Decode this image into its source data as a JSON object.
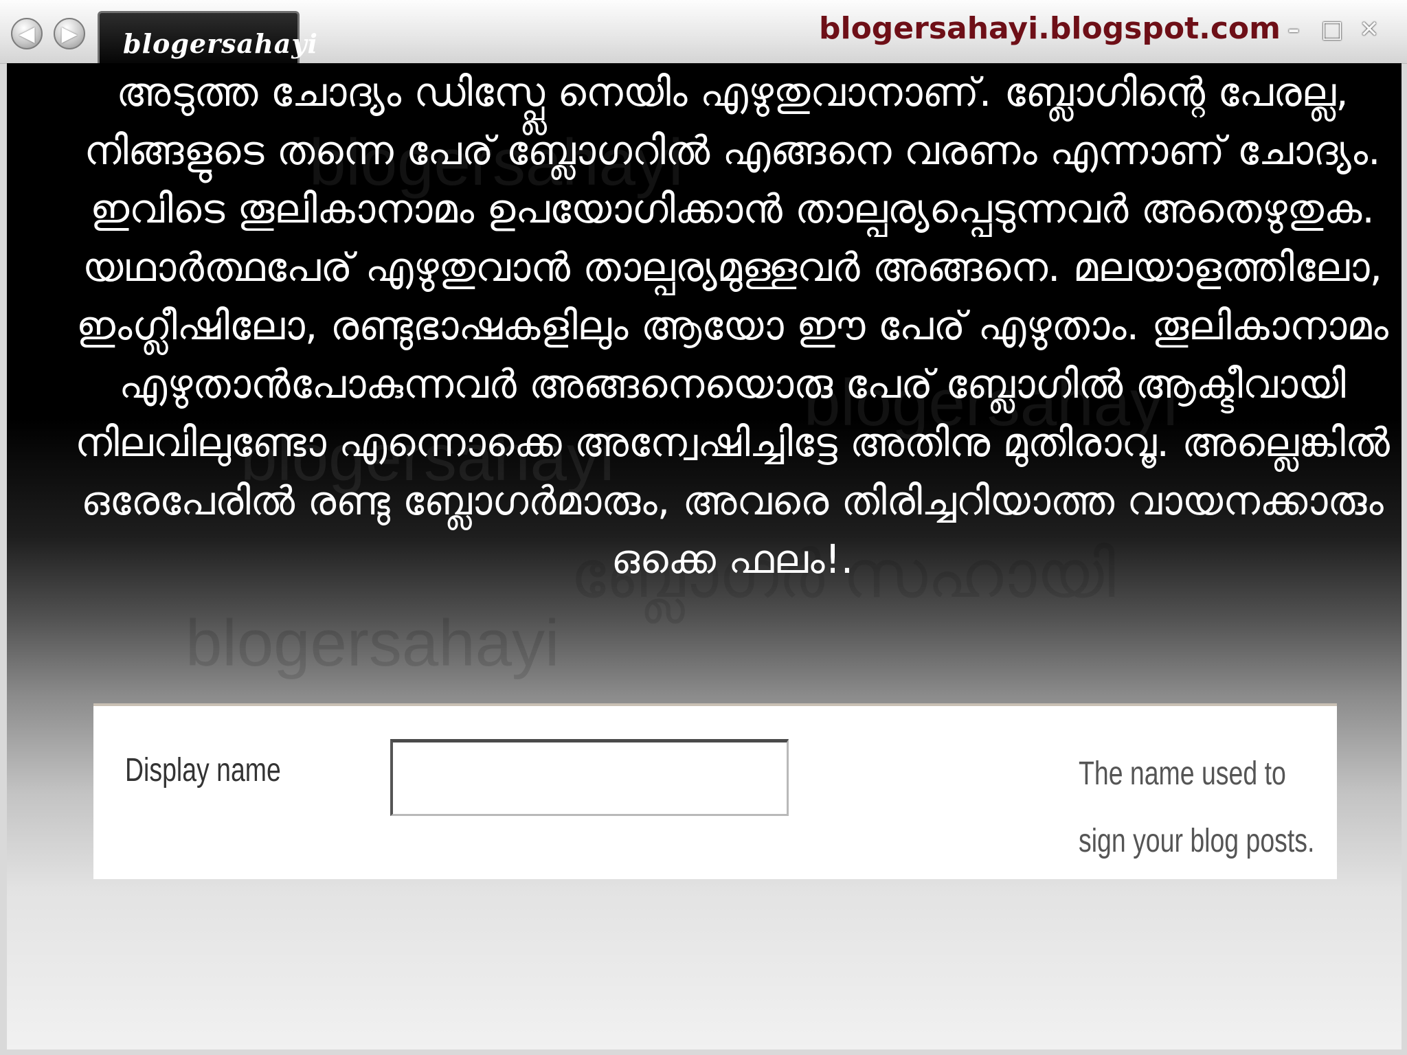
{
  "titlebar": {
    "tab_label": "blogersahayi",
    "site_url": "blogersahayi.blogspot.com",
    "back_icon": "arrow-left-icon",
    "forward_icon": "arrow-right-icon",
    "minimize_icon": "minimize-icon",
    "maximize_icon": "maximize-icon",
    "close_icon": "close-icon"
  },
  "watermarks": [
    "blogersahayi",
    "blogersahayi",
    "blogersahayi",
    "blogersahayi",
    "ബ്ലോഗർ സഹായി"
  ],
  "main": {
    "paragraph": "അടുത്ത ചോദ്യം ഡിസ്പ്ലേ നെയിം എഴുതുവാനാണ്. ബ്ലോഗിന്റെ പേരല്ല, നിങ്ങളുടെ തന്നെ പേര് ബ്ലോഗറിൽ എങ്ങനെ വരണം എന്നാണ് ചോദ്യം. ഇവിടെ തൂലികാനാമം ഉപയോഗിക്കാൻ താല്പര്യപ്പെടുന്നവർ അതെഴുതുക. യഥാർത്ഥപേര് എഴുതുവാൻ താല്പര്യമുള്ളവർ അങ്ങനെ. മലയാളത്തിലോ, ഇംഗ്ലീഷിലോ, രണ്ടുഭാഷകളിലും ആയോ ഈ പേര് എഴുതാം. തൂലികാനാമം എഴുതാൻപോകുന്നവർ അങ്ങനെയൊരു പേര് ബ്ലോഗിൽ ആക്ടീവായി നിലവിലുണ്ടോ എന്നൊക്കെ അന്വേഷിച്ചിട്ടേ അതിനു മുതിരാവൂ. അല്ലെങ്കിൽ ഒരേപേരിൽ രണ്ടു ബ്ലോഗർമാരും, അവരെ തിരിച്ചറിയാത്ത വായനക്കാരും ഒക്കെ ഫലം!."
  },
  "form": {
    "label": "Display name",
    "input_value": "",
    "help_text": "The name used to sign your blog posts."
  }
}
